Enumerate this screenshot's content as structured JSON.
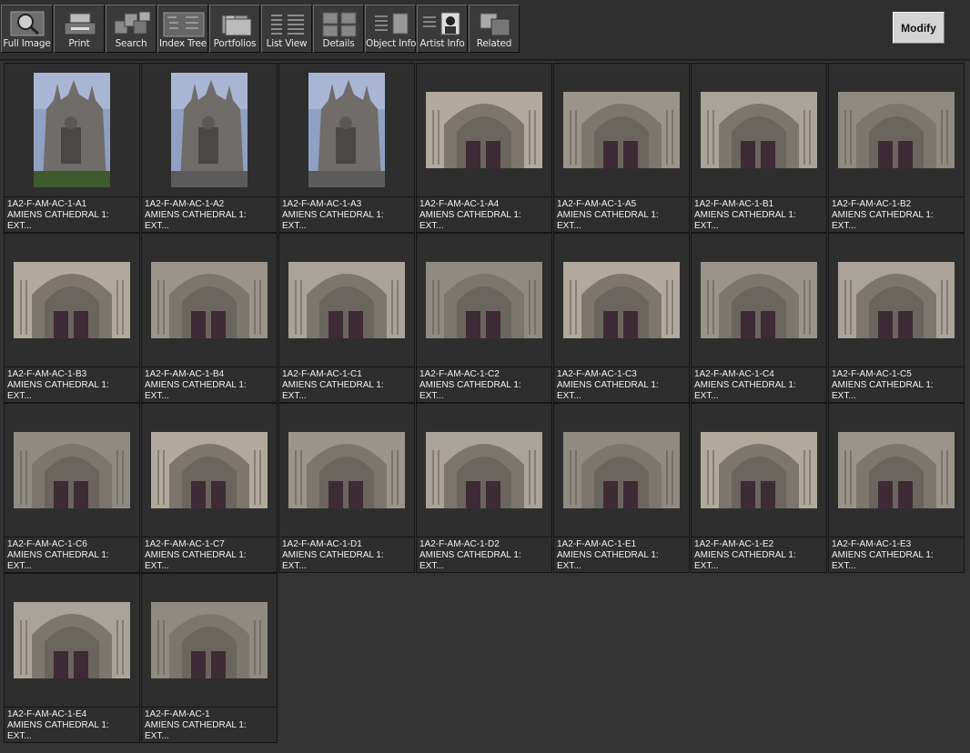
{
  "toolbar": {
    "buttons": [
      {
        "label": "Full Image",
        "icon": "magnifier-icon"
      },
      {
        "label": "Print",
        "icon": "printer-icon"
      },
      {
        "label": "Search",
        "icon": "search-icon"
      },
      {
        "label": "Index Tree",
        "icon": "index-tree-icon"
      },
      {
        "label": "Portfolios",
        "icon": "folder-icon"
      },
      {
        "label": "List View",
        "icon": "list-view-icon"
      },
      {
        "label": "Details",
        "icon": "details-icon"
      },
      {
        "label": "Object Info",
        "icon": "object-info-icon"
      },
      {
        "label": "Artist  Info",
        "icon": "artist-portrait-icon"
      },
      {
        "label": "Related",
        "icon": "related-icon"
      }
    ],
    "modify_label": "Modify"
  },
  "thumbnails": [
    {
      "id": "1A2-F-AM-AC-1-A1",
      "title": "AMIENS CATHEDRAL 1:",
      "desc": "EXT...",
      "orientation": "portrait"
    },
    {
      "id": "1A2-F-AM-AC-1-A2",
      "title": "AMIENS CATHEDRAL 1:",
      "desc": "EXT...",
      "orientation": "portrait"
    },
    {
      "id": "1A2-F-AM-AC-1-A3",
      "title": "AMIENS CATHEDRAL 1:",
      "desc": "EXT...",
      "orientation": "portrait"
    },
    {
      "id": "1A2-F-AM-AC-1-A4",
      "title": "AMIENS CATHEDRAL 1:",
      "desc": "EXT...",
      "orientation": "landscape"
    },
    {
      "id": "1A2-F-AM-AC-1-A5",
      "title": "AMIENS CATHEDRAL 1:",
      "desc": "EXT...",
      "orientation": "landscape"
    },
    {
      "id": "1A2-F-AM-AC-1-B1",
      "title": "AMIENS CATHEDRAL 1:",
      "desc": "EXT...",
      "orientation": "landscape"
    },
    {
      "id": "1A2-F-AM-AC-1-B2",
      "title": "AMIENS CATHEDRAL 1:",
      "desc": "EXT...",
      "orientation": "landscape"
    },
    {
      "id": "1A2-F-AM-AC-1-B3",
      "title": "AMIENS CATHEDRAL 1:",
      "desc": "EXT...",
      "orientation": "landscape"
    },
    {
      "id": "1A2-F-AM-AC-1-B4",
      "title": "AMIENS CATHEDRAL 1:",
      "desc": "EXT...",
      "orientation": "landscape"
    },
    {
      "id": "1A2-F-AM-AC-1-C1",
      "title": "AMIENS CATHEDRAL 1:",
      "desc": "EXT...",
      "orientation": "landscape"
    },
    {
      "id": "1A2-F-AM-AC-1-C2",
      "title": "AMIENS CATHEDRAL 1:",
      "desc": "EXT...",
      "orientation": "landscape"
    },
    {
      "id": "1A2-F-AM-AC-1-C3",
      "title": "AMIENS CATHEDRAL 1:",
      "desc": "EXT...",
      "orientation": "landscape"
    },
    {
      "id": "1A2-F-AM-AC-1-C4",
      "title": "AMIENS CATHEDRAL 1:",
      "desc": "EXT...",
      "orientation": "landscape"
    },
    {
      "id": "1A2-F-AM-AC-1-C5",
      "title": "AMIENS CATHEDRAL 1:",
      "desc": "EXT...",
      "orientation": "landscape"
    },
    {
      "id": "1A2-F-AM-AC-1-C6",
      "title": "AMIENS CATHEDRAL 1:",
      "desc": "EXT...",
      "orientation": "landscape"
    },
    {
      "id": "1A2-F-AM-AC-1-C7",
      "title": "AMIENS CATHEDRAL 1:",
      "desc": "EXT...",
      "orientation": "landscape"
    },
    {
      "id": "1A2-F-AM-AC-1-D1",
      "title": "AMIENS CATHEDRAL 1:",
      "desc": "EXT...",
      "orientation": "landscape"
    },
    {
      "id": "1A2-F-AM-AC-1-D2",
      "title": "AMIENS CATHEDRAL 1:",
      "desc": "EXT...",
      "orientation": "landscape"
    },
    {
      "id": "1A2-F-AM-AC-1-E1",
      "title": "AMIENS CATHEDRAL 1:",
      "desc": "EXT...",
      "orientation": "landscape"
    },
    {
      "id": "1A2-F-AM-AC-1-E2",
      "title": "AMIENS CATHEDRAL 1:",
      "desc": "EXT...",
      "orientation": "landscape"
    },
    {
      "id": "1A2-F-AM-AC-1-E3",
      "title": "AMIENS CATHEDRAL 1:",
      "desc": "EXT...",
      "orientation": "landscape"
    },
    {
      "id": "1A2-F-AM-AC-1-E4",
      "title": "AMIENS CATHEDRAL 1:",
      "desc": "EXT...",
      "orientation": "landscape"
    },
    {
      "id": "1A2-F-AM-AC-1",
      "title": "AMIENS CATHEDRAL 1:",
      "desc": "EXT...",
      "orientation": "landscape"
    }
  ]
}
